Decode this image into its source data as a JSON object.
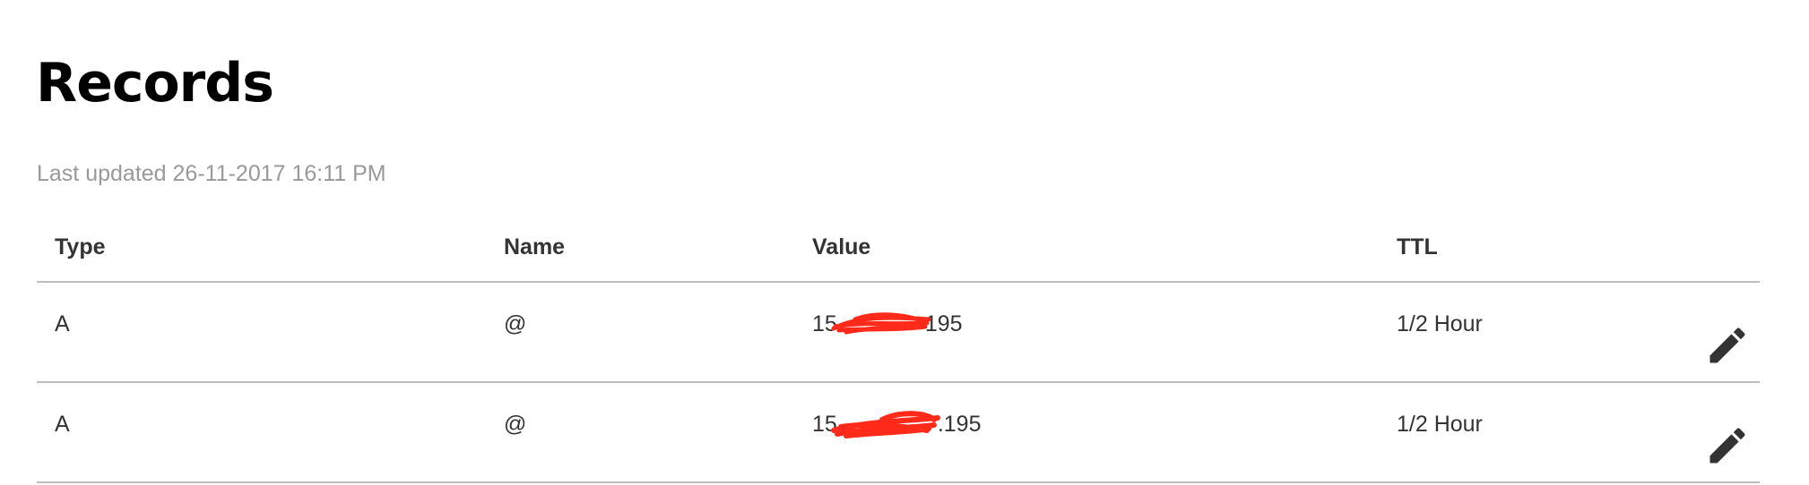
{
  "page": {
    "title": "Records",
    "last_updated": "Last updated 26-11-2017 16:11 PM"
  },
  "table": {
    "headers": [
      "Type",
      "Name",
      "Value",
      "TTL"
    ],
    "rows": [
      {
        "type": "A",
        "name": "@",
        "value_prefix": "15",
        "value_suffix": "195",
        "ttl": "1/2 Hour",
        "action_icon": "pencil-icon"
      },
      {
        "type": "A",
        "name": "@",
        "value_prefix": "15",
        "value_suffix": ".195",
        "ttl": "1/2 Hour",
        "action_icon": "pencil-icon"
      }
    ]
  },
  "colors": {
    "text": "#333333",
    "muted": "#999999",
    "divider": "#bdbdbd",
    "redaction": "#ff2a1a"
  }
}
